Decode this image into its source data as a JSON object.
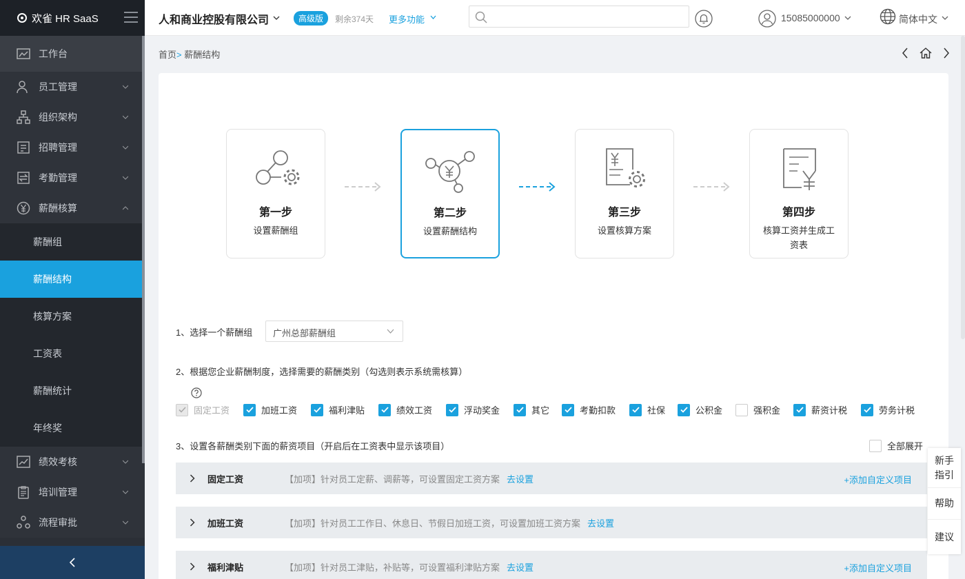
{
  "app": {
    "logo_text": "欢雀 HR SaaS"
  },
  "sidebar": {
    "top_item": "工作台",
    "items": [
      {
        "label": "员工管理"
      },
      {
        "label": "组织架构"
      },
      {
        "label": "招聘管理"
      },
      {
        "label": "考勤管理"
      },
      {
        "label": "薪酬核算",
        "expanded": true
      }
    ],
    "sub_items": [
      "薪酬组",
      "薪酬结构",
      "核算方案",
      "工资表",
      "薪酬统计",
      "年终奖"
    ],
    "active_sub": "薪酬结构",
    "bottom_items": [
      {
        "label": "绩效考核"
      },
      {
        "label": "培训管理"
      },
      {
        "label": "流程审批"
      }
    ],
    "collapse_icon": "chevron-left-icon"
  },
  "header": {
    "company": "人和商业控股有限公司",
    "edition_badge": "高级版",
    "remaining": "剩余374天",
    "more": "更多功能",
    "search_placeholder": "",
    "user_phone": "15085000000",
    "language": "简体中文"
  },
  "breadcrumb": {
    "home": "首页",
    "separator": ">",
    "current": "薪酬结构"
  },
  "steps": [
    {
      "title": "第一步",
      "desc": "设置薪酬组",
      "active": false
    },
    {
      "title": "第二步",
      "desc": "设置薪酬结构",
      "active": true
    },
    {
      "title": "第三步",
      "desc": "设置核算方案",
      "active": false
    },
    {
      "title": "第四步",
      "desc": "核算工资并生成工资表",
      "active": false
    }
  ],
  "section1": {
    "label": "1、选择一个薪酬组",
    "selected": "广州总部薪酬组"
  },
  "section2": {
    "label": "2、根据您企业薪酬制度，选择需要的薪酬类别（勾选则表示系统需核算）",
    "options": [
      {
        "label": "固定工资",
        "checked": true,
        "disabled": true
      },
      {
        "label": "加班工资",
        "checked": true
      },
      {
        "label": "福利津贴",
        "checked": true
      },
      {
        "label": "绩效工资",
        "checked": true
      },
      {
        "label": "浮动奖金",
        "checked": true
      },
      {
        "label": "其它",
        "checked": true
      },
      {
        "label": "考勤扣款",
        "checked": true
      },
      {
        "label": "社保",
        "checked": true
      },
      {
        "label": "公积金",
        "checked": true
      },
      {
        "label": "强积金",
        "checked": false
      },
      {
        "label": "薪资计税",
        "checked": true
      },
      {
        "label": "劳务计税",
        "checked": true
      }
    ]
  },
  "section3": {
    "label": "3、设置各薪酬类别下面的薪资项目（开启后在工资表中显示该项目）",
    "expand_all": "全部展开",
    "categories": [
      {
        "name": "固定工资",
        "desc": "【加项】针对员工定薪、调薪等，可设置固定工资方案",
        "link": "去设置",
        "add": "+添加自定义项目"
      },
      {
        "name": "加班工资",
        "desc": "【加项】针对员工工作日、休息日、节假日加班工资，可设置加班工资方案",
        "link": "去设置",
        "add": ""
      },
      {
        "name": "福利津贴",
        "desc": "【加项】针对员工津贴，补贴等，可设置福利津贴方案",
        "link": "去设置",
        "add": "+添加自定义项目"
      }
    ]
  },
  "float_bar": {
    "guide": "新手指引",
    "help": "帮助",
    "suggest": "建议"
  },
  "colors": {
    "accent": "#1aa1de",
    "sidebar": "#2b2f36",
    "sidebar_footer": "#1d3f63"
  }
}
